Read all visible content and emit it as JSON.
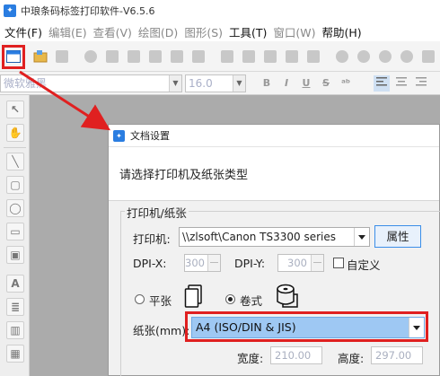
{
  "app": {
    "title": "中琅条码标签打印软件-V6.5.6",
    "icon": "app-logo-icon"
  },
  "menubar": {
    "items": [
      {
        "label": "文件(F)",
        "dim": false
      },
      {
        "label": "编辑(E)",
        "dim": true
      },
      {
        "label": "查看(V)",
        "dim": true
      },
      {
        "label": "绘图(D)",
        "dim": true
      },
      {
        "label": "图形(S)",
        "dim": true
      },
      {
        "label": "工具(T)",
        "dim": false
      },
      {
        "label": "窗口(W)",
        "dim": true
      },
      {
        "label": "帮助(H)",
        "dim": false
      }
    ]
  },
  "format_toolbar": {
    "font_value": "微软雅黑",
    "size_value": "16.0",
    "bold": "B",
    "italic": "I",
    "underline": "U",
    "strike": "S"
  },
  "dialog": {
    "title": "文档设置",
    "header_text": "请选择打印机及纸张类型",
    "group_label": "打印机/纸张",
    "printer_label": "打印机:",
    "printer_value": "\\\\zlsoft\\Canon TS3300 series",
    "properties_button": "属性",
    "dpi_x_label": "DPI-X:",
    "dpi_x_value": "300",
    "dpi_y_label": "DPI-Y:",
    "dpi_y_value": "300",
    "custom_label": "自定义",
    "radio_flat": "平张",
    "radio_roll": "卷式",
    "roll_selected": true,
    "paper_label": "纸张(mm):",
    "paper_value": "A4 (ISO/DIN & JIS)",
    "width_label": "宽度:",
    "width_value": "210.00",
    "height_label": "高度:",
    "height_value": "297.00"
  },
  "colors": {
    "highlight": "#e02020",
    "selection": "#9ec8f3",
    "accent": "#2a7de1"
  }
}
